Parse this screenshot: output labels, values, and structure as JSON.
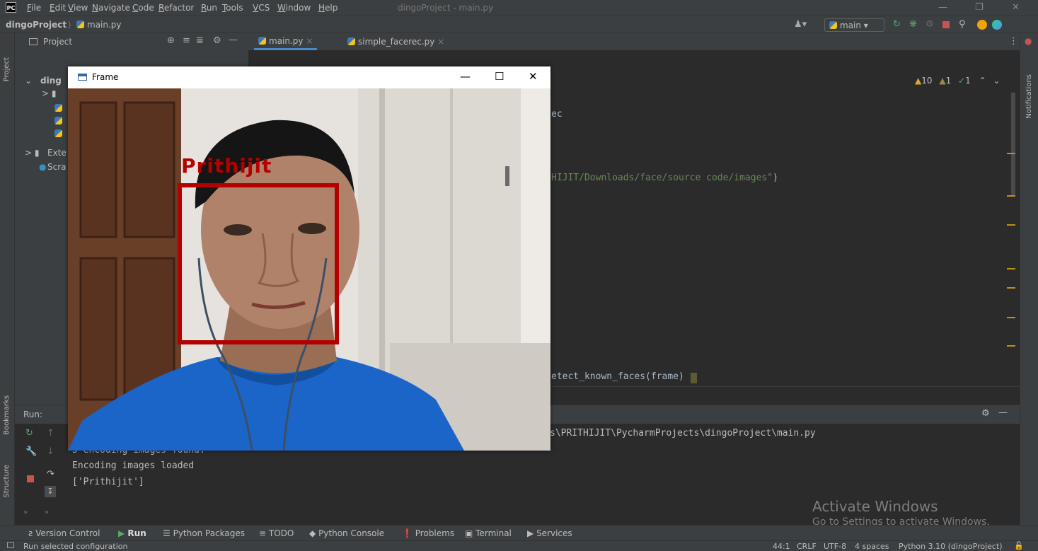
{
  "app": {
    "menu": [
      "File",
      "Edit",
      "View",
      "Navigate",
      "Code",
      "Refactor",
      "Run",
      "Tools",
      "VCS",
      "Window",
      "Help"
    ],
    "window_title": "dingoProject - main.py"
  },
  "navbar": {
    "project": "dingoProject",
    "file": "main.py",
    "branch": "main"
  },
  "project_panel": {
    "header": "Project",
    "tree": [
      "ding",
      "Exte",
      "Scra"
    ]
  },
  "tabs": [
    {
      "label": "main.py",
      "active": true
    },
    {
      "label": "simple_facerec.py",
      "active": false
    }
  ],
  "editor": {
    "visible_code": {
      "line1": "ec",
      "line2_str": "HIJIT/Downloads/face/source code/images\"",
      "line2_end": ")",
      "line3": "etect_known_faces(frame)"
    },
    "inspections": {
      "warnings": "10",
      "weak_warnings": "1",
      "typos": "1"
    }
  },
  "run": {
    "label": "Run:",
    "path_line": "s\\PRITHIJIT\\PycharmProjects\\dingoProject\\main.py",
    "output": [
      "5 encoding images found.",
      "Encoding images loaded",
      "['Prithijit']"
    ]
  },
  "left_stripe": {
    "project": "Project",
    "bookmarks": "Bookmarks",
    "structure": "Structure"
  },
  "right_stripe": {
    "notifications": "Notifications"
  },
  "bottom_tools": [
    "Version Control",
    "Run",
    "Python Packages",
    "TODO",
    "Python Console",
    "Problems",
    "Terminal",
    "Services"
  ],
  "status": {
    "left": "Run selected configuration",
    "position": "44:1",
    "line_sep": "CRLF",
    "encoding": "UTF-8",
    "indent": "4 spaces",
    "interpreter": "Python 3.10 (dingoProject)"
  },
  "watermark": {
    "title": "Activate Windows",
    "subtitle": "Go to Settings to activate Windows."
  },
  "frame_window": {
    "title": "Frame",
    "face_label": "Prithijit",
    "label_color": "#b30000"
  }
}
